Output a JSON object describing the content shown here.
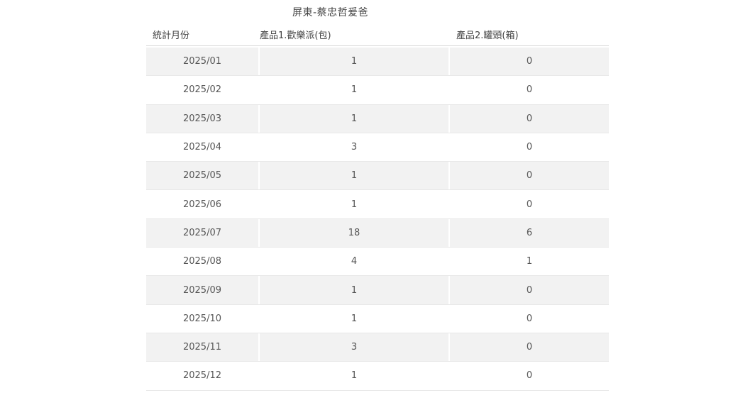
{
  "title": "屏東-蔡忠哲爰爸",
  "columns": {
    "month": "統計月份",
    "product1": "產品1.歡樂派(包)",
    "product2": "產品2.罐頭(箱)"
  },
  "rows": [
    {
      "month": "2025/01",
      "p1": "1",
      "p2": "0"
    },
    {
      "month": "2025/02",
      "p1": "1",
      "p2": "0"
    },
    {
      "month": "2025/03",
      "p1": "1",
      "p2": "0"
    },
    {
      "month": "2025/04",
      "p1": "3",
      "p2": "0"
    },
    {
      "month": "2025/05",
      "p1": "1",
      "p2": "0"
    },
    {
      "month": "2025/06",
      "p1": "1",
      "p2": "0"
    },
    {
      "month": "2025/07",
      "p1": "18",
      "p2": "6"
    },
    {
      "month": "2025/08",
      "p1": "4",
      "p2": "1"
    },
    {
      "month": "2025/09",
      "p1": "1",
      "p2": "0"
    },
    {
      "month": "2025/10",
      "p1": "1",
      "p2": "0"
    },
    {
      "month": "2025/11",
      "p1": "3",
      "p2": "0"
    },
    {
      "month": "2025/12",
      "p1": "1",
      "p2": "0"
    }
  ]
}
